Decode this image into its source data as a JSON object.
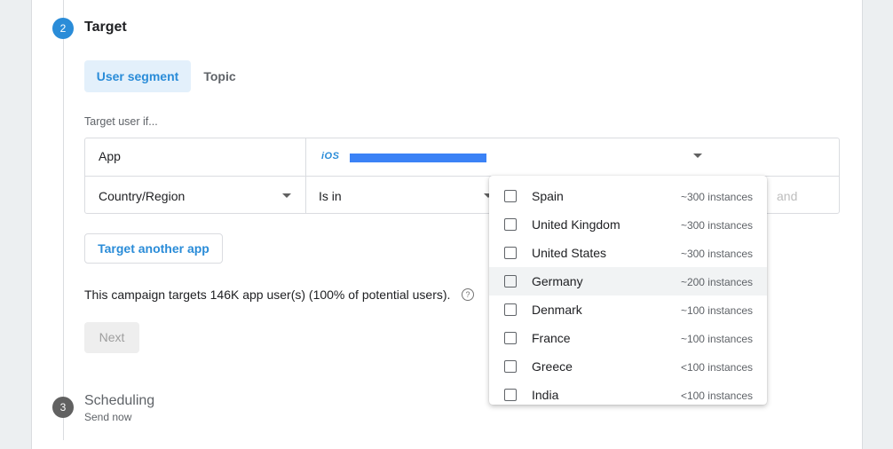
{
  "step2": {
    "number": "2",
    "title": "Target"
  },
  "tabs": [
    {
      "label": "User segment",
      "active": true
    },
    {
      "label": "Topic",
      "active": false
    }
  ],
  "target_if_label": "Target user if...",
  "conditions": {
    "row1": {
      "field": "App",
      "platform_badge": "iOS"
    },
    "row2": {
      "field": "Country/Region",
      "operator": "Is in",
      "joiner": "and"
    }
  },
  "target_another_app_label": "Target another app",
  "summary_text": "This campaign targets 146K app user(s) (100% of potential users).",
  "help_icon": "?",
  "next_label": "Next",
  "step3": {
    "number": "3",
    "title": "Scheduling",
    "subtitle": "Send now"
  },
  "dropdown": {
    "items": [
      {
        "label": "Spain",
        "count": "~300 instances"
      },
      {
        "label": "United Kingdom",
        "count": "~300 instances"
      },
      {
        "label": "United States",
        "count": "~300 instances"
      },
      {
        "label": "Germany",
        "count": "~200 instances"
      },
      {
        "label": "Denmark",
        "count": "~100 instances"
      },
      {
        "label": "France",
        "count": "~100 instances"
      },
      {
        "label": "Greece",
        "count": "<100 instances"
      },
      {
        "label": "India",
        "count": "<100 instances"
      }
    ]
  },
  "colors": {
    "accent": "#2a8cd8",
    "redaction": "#3b82f6"
  }
}
